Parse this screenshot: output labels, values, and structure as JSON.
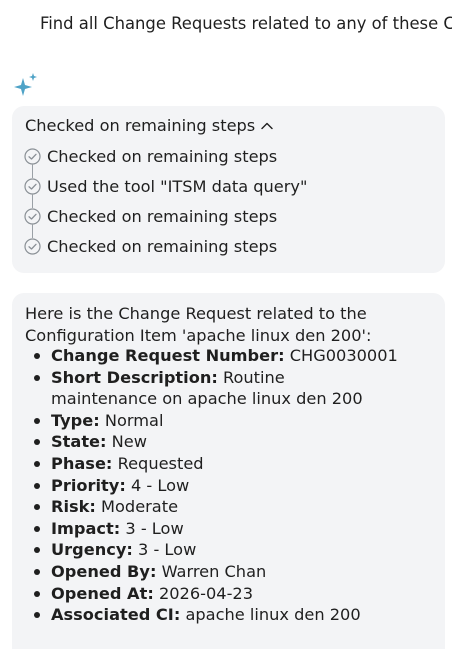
{
  "user_message": "Find all Change Requests related to any of these CIs",
  "accent_color": "#4fa3c7",
  "steps": {
    "header": "Checked on remaining steps",
    "items": [
      {
        "label": "Checked on remaining steps"
      },
      {
        "label": "Used the tool \"ITSM data query\""
      },
      {
        "label": "Checked on remaining steps"
      },
      {
        "label": "Checked on remaining steps"
      }
    ]
  },
  "answer": {
    "intro": "Here is the Change Request related to the Configuration Item 'apache linux den 200':",
    "details": [
      {
        "key": "Change Request Number:",
        "value": "CHG0030001"
      },
      {
        "key": "Short Description:",
        "value": "Routine maintenance on apache linux den 200"
      },
      {
        "key": "Type:",
        "value": "Normal"
      },
      {
        "key": "State:",
        "value": "New"
      },
      {
        "key": "Phase:",
        "value": "Requested"
      },
      {
        "key": "Priority:",
        "value": "4 - Low"
      },
      {
        "key": "Risk:",
        "value": "Moderate"
      },
      {
        "key": "Impact:",
        "value": "3 - Low"
      },
      {
        "key": "Urgency:",
        "value": "3 - Low"
      },
      {
        "key": "Opened By:",
        "value": "Warren Chan"
      },
      {
        "key": "Opened At:",
        "value": "2026-04-23"
      },
      {
        "key": "Associated CI:",
        "value": "apache linux den 200"
      }
    ]
  }
}
